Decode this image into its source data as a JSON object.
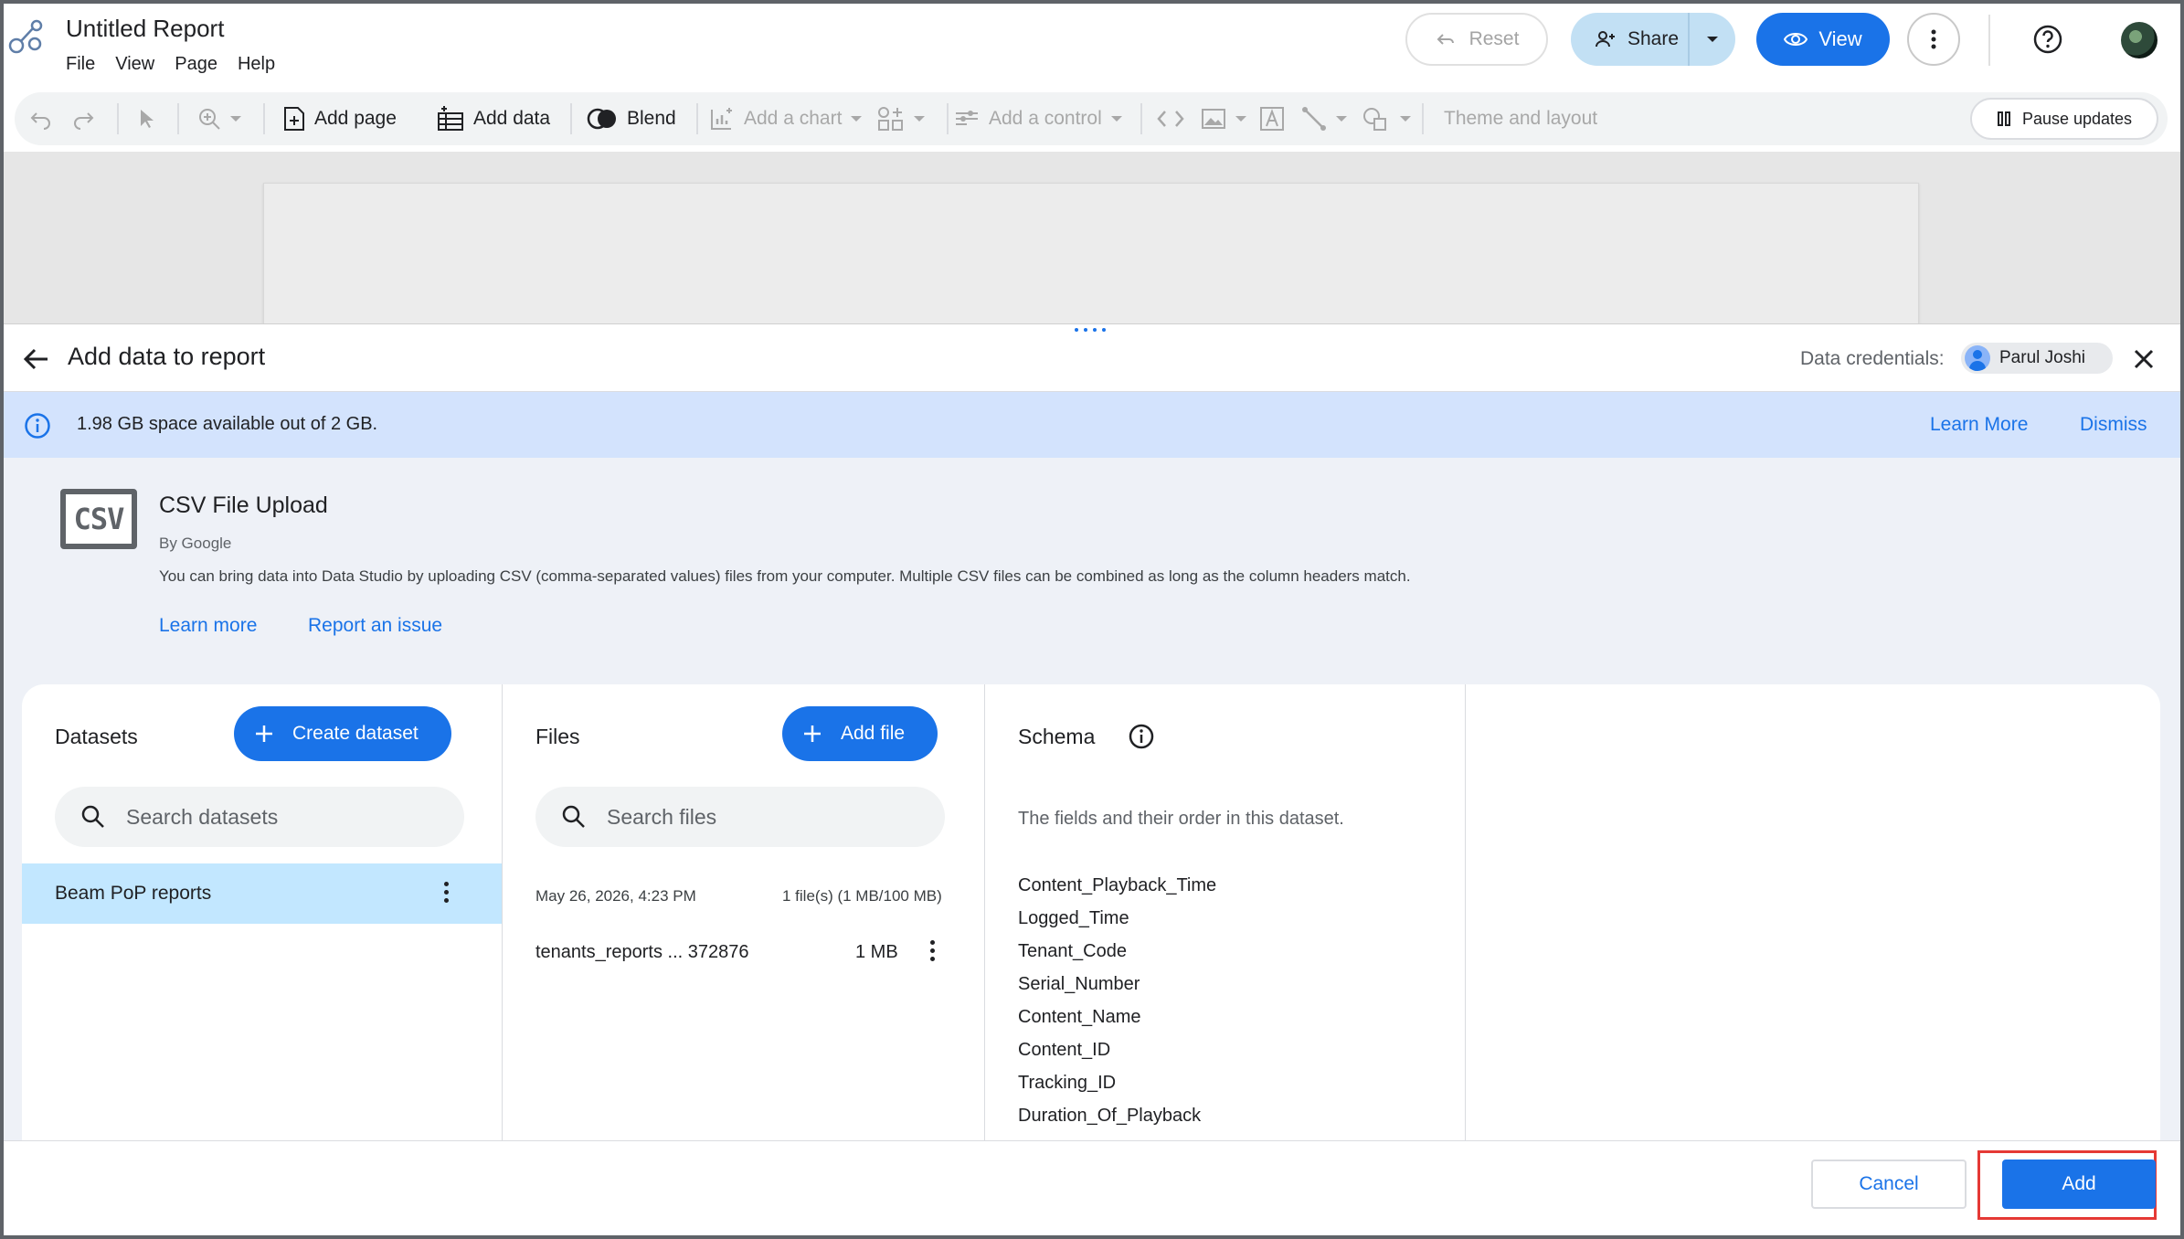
{
  "app": {
    "title": "Untitled Report",
    "menu": [
      "File",
      "View",
      "Page",
      "Help"
    ]
  },
  "header_actions": {
    "reset_label": "Reset",
    "share_label": "Share",
    "view_label": "View"
  },
  "toolbar": {
    "add_page": "Add page",
    "add_data": "Add data",
    "blend": "Blend",
    "add_chart": "Add a chart",
    "add_control": "Add a control",
    "theme_layout": "Theme and layout",
    "pause_updates": "Pause updates"
  },
  "panel": {
    "title": "Add data to report",
    "credentials_label": "Data credentials:",
    "credentials_user": "Parul Joshi",
    "info_text": "1.98 GB space available out of 2 GB.",
    "learn_more": "Learn More",
    "dismiss": "Dismiss"
  },
  "connector": {
    "logo_text": "CSV",
    "name": "CSV File Upload",
    "by": "By Google",
    "description": "You can bring data into Data Studio by uploading CSV (comma-separated values) files from your computer. Multiple CSV files can be combined as long as the column headers match.",
    "learn_more": "Learn more",
    "report_issue": "Report an issue"
  },
  "datasets": {
    "title": "Datasets",
    "create_label": "Create dataset",
    "search_placeholder": "Search datasets",
    "items": [
      {
        "name": "Beam PoP reports",
        "selected": true
      }
    ]
  },
  "files": {
    "title": "Files",
    "add_label": "Add file",
    "search_placeholder": "Search files",
    "uploaded_at": "May 26, 2026, 4:23 PM",
    "summary": "1 file(s) (1 MB/100 MB)",
    "items": [
      {
        "name": "tenants_reports ... 372876",
        "size": "1 MB"
      }
    ]
  },
  "schema": {
    "title": "Schema",
    "description": "The fields and their order in this dataset.",
    "fields": [
      "Content_Playback_Time",
      "Logged_Time",
      "Tenant_Code",
      "Serial_Number",
      "Content_Name",
      "Content_ID",
      "Tracking_ID",
      "Duration_Of_Playback"
    ]
  },
  "footer": {
    "cancel_label": "Cancel",
    "add_label": "Add"
  },
  "colors": {
    "primary": "#1a73e8",
    "info_bg": "#d3e3fd",
    "selected_row": "#c2e7ff",
    "highlight": "#e53935"
  }
}
